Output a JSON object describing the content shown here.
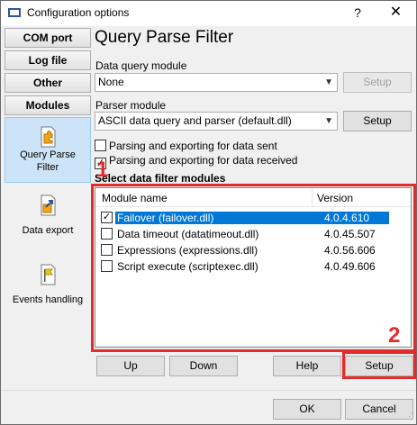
{
  "window": {
    "title": "Configuration options",
    "help_glyph": "?",
    "close_glyph": "✕"
  },
  "nav": {
    "buttons": [
      {
        "label": "COM port"
      },
      {
        "label": "Log file"
      },
      {
        "label": "Other"
      },
      {
        "label": "Modules"
      }
    ],
    "items": [
      {
        "label_line1": "Query Parse",
        "label_line2": "Filter",
        "selected": true,
        "icon": "puzzle-icon"
      },
      {
        "label_line1": "Data export",
        "label_line2": "",
        "selected": false,
        "icon": "export-icon"
      },
      {
        "label_line1": "Events handling",
        "label_line2": "",
        "selected": false,
        "icon": "flag-icon"
      }
    ]
  },
  "page": {
    "heading": "Query Parse Filter",
    "data_query_label": "Data query module",
    "data_query_value": "None",
    "data_query_setup": "Setup",
    "parser_label": "Parser module",
    "parser_value": "ASCII data query and parser (default.dll)",
    "parser_setup": "Setup",
    "chk_sent": {
      "label": "Parsing and exporting for data sent",
      "checked": false
    },
    "chk_received": {
      "label": "Parsing and exporting for data received",
      "checked": true
    },
    "filter_title": "Select data filter modules",
    "columns": {
      "name": "Module name",
      "version": "Version"
    },
    "rows": [
      {
        "name": "Failover (failover.dll)",
        "version": "4.0.4.610",
        "checked": true,
        "selected": true
      },
      {
        "name": "Data timeout (datatimeout.dll)",
        "version": "4.0.45.507",
        "checked": false,
        "selected": false
      },
      {
        "name": "Expressions (expressions.dll)",
        "version": "4.0.56.606",
        "checked": false,
        "selected": false
      },
      {
        "name": "Script execute (scriptexec.dll)",
        "version": "4.0.49.606",
        "checked": false,
        "selected": false
      }
    ],
    "buttons": {
      "up": "Up",
      "down": "Down",
      "help": "Help",
      "setup": "Setup"
    }
  },
  "annotations": {
    "marker1": "1",
    "marker2": "2",
    "color": "#e32b2b"
  },
  "footer": {
    "ok": "OK",
    "cancel": "Cancel"
  },
  "colors": {
    "selection": "#0078d7",
    "nav_selected": "#cde3f7"
  }
}
